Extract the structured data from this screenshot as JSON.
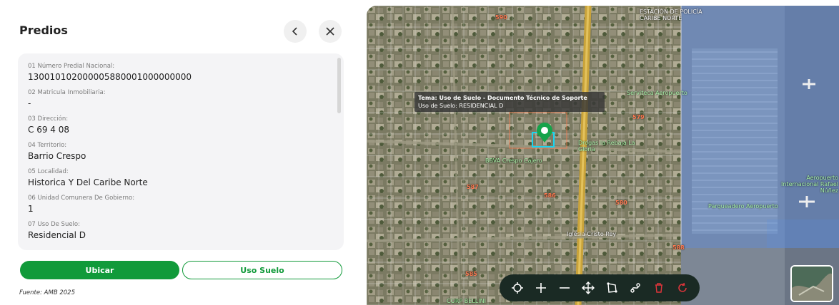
{
  "panel": {
    "title": "Predios",
    "attributes": [
      {
        "label": "01 Número Predial Nacional:",
        "value": "130010102000005880001000000000"
      },
      {
        "label": "02 Matricula Inmobiliaria:",
        "value": "-"
      },
      {
        "label": "03 Dirección:",
        "value": "C 69 4 08"
      },
      {
        "label": "04 Territorio:",
        "value": "Barrio Crespo"
      },
      {
        "label": "05 Localidad:",
        "value": "Historica Y Del Caribe Norte"
      },
      {
        "label": "06 Unidad Comunera De Gobierno:",
        "value": "1"
      },
      {
        "label": "07 Uso De Suelo:",
        "value": "Residencial D"
      }
    ],
    "buttons": {
      "ubicar": "Ubicar",
      "uso_suelo": "Uso Suelo"
    },
    "source": "Fuente: AMB 2025"
  },
  "map": {
    "tooltip": {
      "title": "Tema: Uso de Suelo - Documento Técnico de Soporte",
      "subtitle": "Uso de Suelo: RESIDENCIAL D"
    },
    "labels": {
      "n590": "590",
      "n579": "579",
      "n587": "587",
      "n586": "586",
      "n585": "585",
      "n588": "588",
      "n580": "580",
      "estacion": "ESTACIÓN DE POLICÍA CARIBE NORTE",
      "bbva": "BBVA Crespo Cajero",
      "drogas": "Drogas la Rebaja La Gloria",
      "iglesia": "Iglesia Cristo Rey",
      "aeropuerto": "Aeropuerto Internacional Rafael Núñez",
      "parqueadero": "Parqueadero Aeropuerto",
      "serviteca": "Serviteca Aeropuerto",
      "corp": "CORP BELLINI"
    }
  },
  "colors": {
    "accent": "#119a3a",
    "toolbar_bg": "#1a2a24",
    "danger": "#e0353b"
  }
}
